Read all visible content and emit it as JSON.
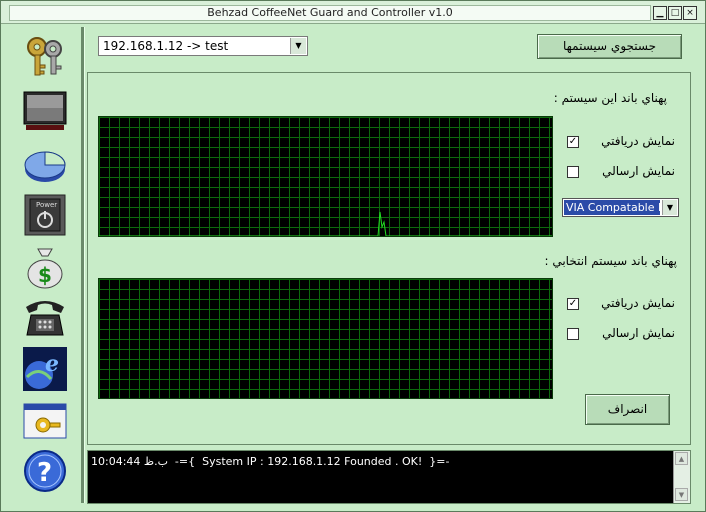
{
  "window": {
    "title": "Behzad CoffeeNet Guard and Controller v1.0",
    "min_glyph": "▁",
    "max_glyph": "□",
    "close_glyph": "×"
  },
  "sidebar": {
    "items": [
      {
        "name": "keys-icon"
      },
      {
        "name": "monitor-icon"
      },
      {
        "name": "pie-chart-icon"
      },
      {
        "name": "power-icon",
        "label": "Power"
      },
      {
        "name": "money-bag-icon"
      },
      {
        "name": "telephone-icon"
      },
      {
        "name": "internet-explorer-icon"
      },
      {
        "name": "settings-window-icon"
      },
      {
        "name": "help-icon",
        "label": "?"
      }
    ]
  },
  "toolbar": {
    "system_select_value": "192.168.1.12 -> test",
    "search_button": "جستجوي سيستمها"
  },
  "bandwidth_this": {
    "label": "پهناي باند اين سيستم :",
    "show_received": "نمايش دريافتي",
    "show_sent": "نمايش ارسالي",
    "received_checked": true,
    "sent_checked": false,
    "adapter_value": "VIA Compatable Fast"
  },
  "bandwidth_selected": {
    "label": "پهناي باند سيستم انتخابي :",
    "show_received": "نمايش دريافتي",
    "show_sent": "نمايش ارسالي",
    "received_checked": true,
    "sent_checked": false
  },
  "cancel_button": "انصراف",
  "log": {
    "line": "10:04:44 ب.ظ  -={  System IP : 192.168.1.12 Founded . OK!  }=-"
  },
  "colors": {
    "background": "#c8ecc8",
    "graph_bg": "#000000",
    "graph_grid": "#0c6a0c",
    "graph_line": "#22dd22"
  }
}
